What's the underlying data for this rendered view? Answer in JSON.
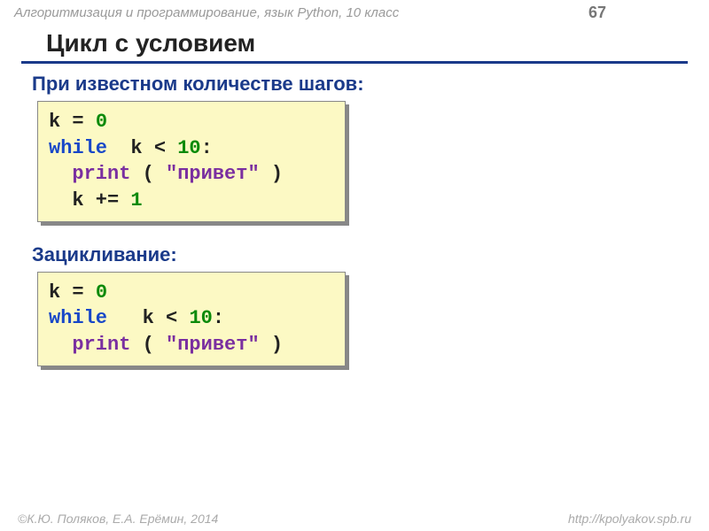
{
  "header": {
    "breadcrumb": "Алгоритмизация и программирование, язык Python, 10 класс",
    "page_number": "67"
  },
  "title": "Цикл с условием",
  "section1": {
    "heading": "При известном количестве шагов:",
    "code": {
      "l1_a": "k = ",
      "l1_num": "0",
      "l2_kw": "while",
      "l2_mid": "  k < ",
      "l2_num": "10",
      "l2_end": ":",
      "l3_pad": "  ",
      "l3_fn": "print",
      "l3_paren_open": " ( ",
      "l3_str": "\"привет\"",
      "l3_paren_close": " )",
      "l4_pad": "  k += ",
      "l4_num": "1"
    }
  },
  "section2": {
    "heading": "Зацикливание:",
    "code": {
      "l1_a": "k = ",
      "l1_num": "0",
      "l2_kw": "while",
      "l2_mid": "   k < ",
      "l2_num": "10",
      "l2_end": ":",
      "l3_pad": "  ",
      "l3_fn": "print",
      "l3_paren_open": " ( ",
      "l3_str": "\"привет\"",
      "l3_paren_close": " )"
    }
  },
  "footer": {
    "copyright": "©К.Ю. Поляков, Е.А. Ерёмин, 2014",
    "url": "http://kpolyakov.spb.ru"
  }
}
